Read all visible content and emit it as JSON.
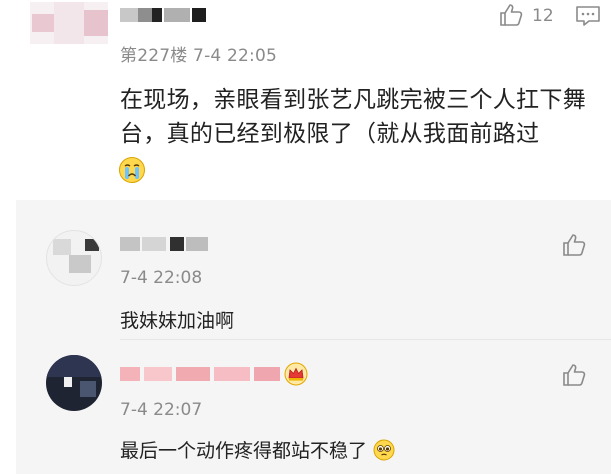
{
  "main_comment": {
    "floor_and_time": "第227楼 7-4 22:05",
    "like_count": "12",
    "content": "在现场，亲眼看到张艺凡跳完被三个人扛下舞台，真的已经到极限了（就从我面前路过",
    "trailing_emoji": "crying-emoji",
    "colors": {
      "text": "#222222",
      "meta": "#8a8a8a"
    }
  },
  "replies": [
    {
      "time": "7-4 22:08",
      "content": "我妹妹加油啊"
    },
    {
      "time": "7-4 22:07",
      "content": "最后一个动作疼得都站不稳了",
      "trailing_emoji": "pleading-emoji",
      "badge_icon": "crown-badge-icon"
    }
  ],
  "colors": {
    "reply_background": "#f5f5f5",
    "meta": "#8a8a8a",
    "icon_stroke": "#8a8a8a"
  }
}
